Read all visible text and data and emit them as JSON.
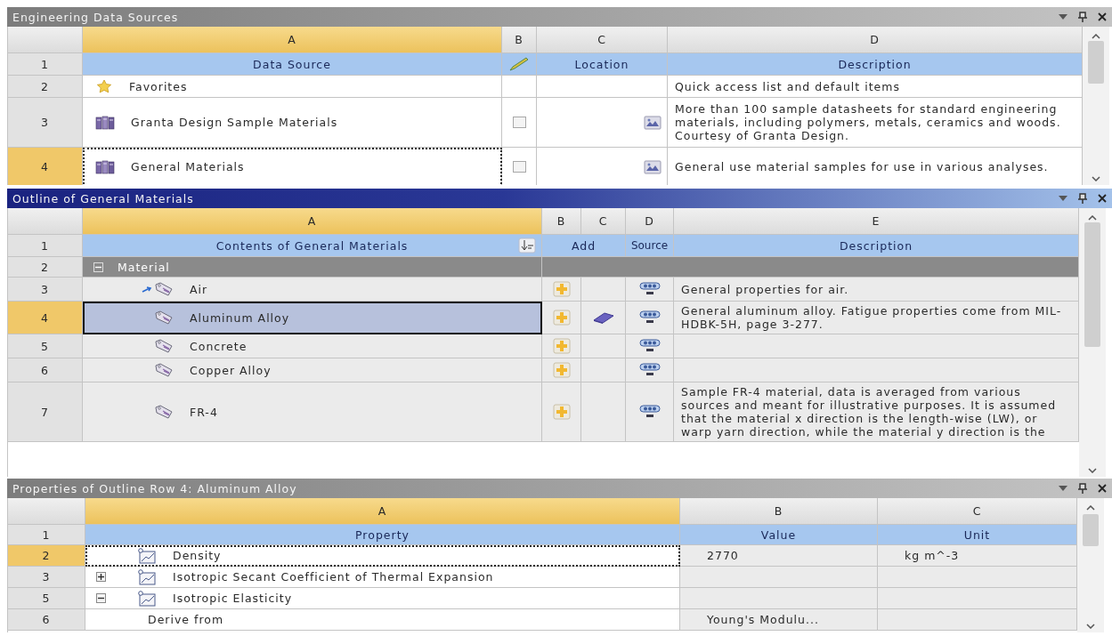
{
  "data_sources": {
    "title": "Engineering Data Sources",
    "active": false,
    "columns": [
      {
        "label": "A",
        "selected": true
      },
      {
        "label": "B",
        "selected": false
      },
      {
        "label": "C",
        "selected": false
      },
      {
        "label": "D",
        "selected": false
      }
    ],
    "heading_number": "1",
    "headings": {
      "source": "Data Source",
      "location": "Location",
      "description": "Description"
    },
    "rows": [
      {
        "number": "2",
        "kind": "favorites",
        "name": "Favorites",
        "selected": false,
        "description": "Quick access list and default items"
      },
      {
        "number": "3",
        "kind": "library",
        "name": "Granta Design Sample Materials",
        "selected": false,
        "checked": false,
        "description": "More than 100 sample datasheets for standard engineering materials, including polymers, metals, ceramics and woods. Courtesy of Granta Design."
      },
      {
        "number": "4",
        "kind": "library",
        "name": "General Materials",
        "selected": true,
        "checked": false,
        "description": "General use material samples for use in various analyses."
      }
    ]
  },
  "outline": {
    "title": "Outline of General Materials",
    "active": true,
    "columns": [
      {
        "label": "A",
        "selected": true
      },
      {
        "label": "B",
        "selected": false
      },
      {
        "label": "C",
        "selected": false
      },
      {
        "label": "D",
        "selected": false
      },
      {
        "label": "E",
        "selected": false
      }
    ],
    "heading_number": "1",
    "headings": {
      "contents": "Contents of General Materials",
      "add": "Add",
      "source": "Source",
      "description": "Description"
    },
    "groups": [
      {
        "number": "2",
        "name": "Material",
        "expanded": true,
        "children": [
          {
            "number": "3",
            "name": "Air",
            "linked": true,
            "customized": false,
            "selected": false,
            "description": "General properties for air."
          },
          {
            "number": "4",
            "name": "Aluminum Alloy",
            "linked": false,
            "customized": true,
            "selected": true,
            "description": "General aluminum alloy. Fatigue properties come from MIL-HDBK-5H, page 3-277."
          },
          {
            "number": "5",
            "name": "Concrete",
            "linked": false,
            "customized": false,
            "selected": false
          },
          {
            "number": "6",
            "name": "Copper Alloy",
            "linked": false,
            "customized": false,
            "selected": false
          },
          {
            "number": "7",
            "name": "FR-4",
            "linked": false,
            "customized": false,
            "selected": false,
            "description": "Sample FR-4 material, data is averaged from various sources and meant for illustrative purposes. It is assumed that the material x direction is the length-wise (LW), or warp yarn direction, while the material y direction is the"
          }
        ]
      }
    ]
  },
  "properties": {
    "title": "Properties of Outline Row 4: Aluminum Alloy",
    "active": false,
    "columns": [
      {
        "label": "A",
        "selected": true
      },
      {
        "label": "B",
        "selected": false
      },
      {
        "label": "C",
        "selected": false
      }
    ],
    "heading_number": "1",
    "headings": {
      "property": "Property",
      "value": "Value",
      "unit": "Unit"
    },
    "rows": [
      {
        "number": "2",
        "name": "Density",
        "selected": true,
        "value": "2770",
        "unit": "kg m^-3"
      },
      {
        "number": "3",
        "name": "Isotropic Secant Coefficient of Thermal Expansion",
        "selected": false,
        "expanded": false
      },
      {
        "number": "5",
        "name": "Isotropic Elasticity",
        "selected": false,
        "expanded": true,
        "children": [
          {
            "number": "6",
            "name": "Derive from",
            "selected": false,
            "value": "Young's Modulu..."
          }
        ]
      }
    ]
  }
}
